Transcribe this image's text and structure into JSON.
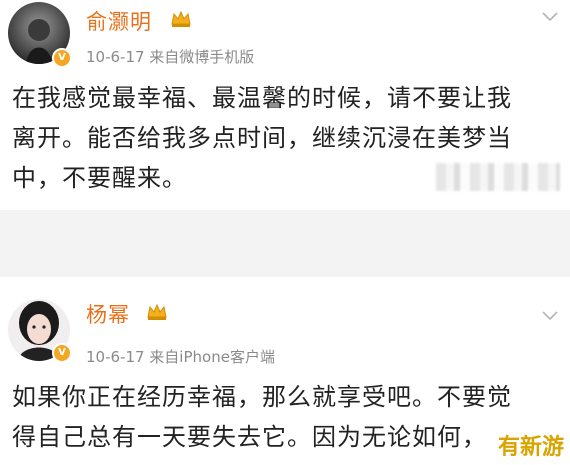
{
  "post1": {
    "username": "俞灏明",
    "meta": "10-6-17  来自微博手机版",
    "body_lines": [
      "在我感觉最幸福、最温馨的时候，请不要让我",
      "离开。能否给我多点时间，继续沉浸在美梦当",
      "中，不要醒来。"
    ]
  },
  "post2": {
    "username": "杨幂",
    "meta": "10-6-17  来自iPhone客户端",
    "body_lines": [
      "如果你正在经历幸福，那么就享受吧。不要觉",
      "得自己总有一天要失去它。因为无论如何，"
    ]
  },
  "watermark": "有新游",
  "colors": {
    "name": "#e8701a",
    "badge": "#f5a623",
    "meta": "#8a8a8a"
  },
  "icons": [
    "avatar",
    "verified-badge-icon",
    "vip-crown-icon",
    "chevron-down-icon"
  ]
}
